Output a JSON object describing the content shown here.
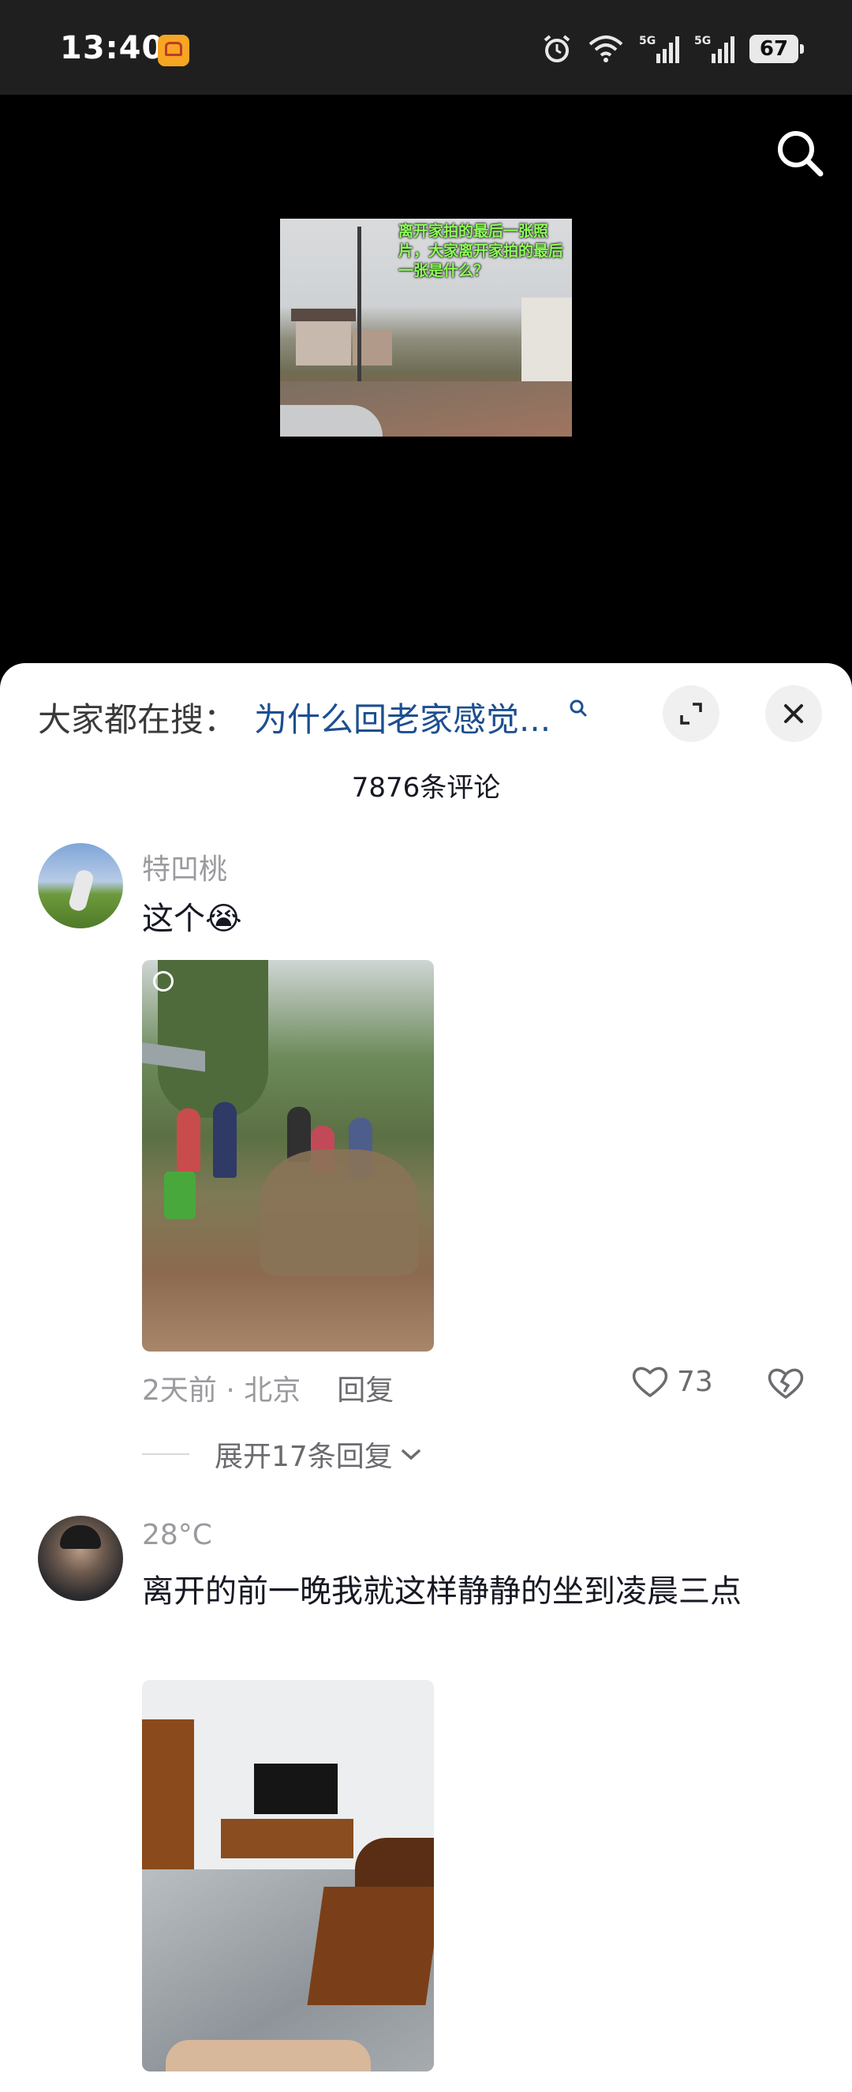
{
  "status_bar": {
    "time": "13:40",
    "battery": "67",
    "icons": [
      "app-icon",
      "alarm-icon",
      "wifi-icon",
      "signal-5g-icon",
      "signal-5g-icon",
      "battery-icon"
    ]
  },
  "video": {
    "caption": "离开家拍的最后一张照片，大家离开家拍的最后一张是什么？"
  },
  "sheet": {
    "trending_label": "大家都在搜：",
    "trending_query": "为什么回老家感觉...",
    "comment_count": "7876条评论"
  },
  "comments": [
    {
      "username": "特凹桃",
      "text": "这个😭",
      "time_location": "2天前 · 北京",
      "reply_label": "回复",
      "likes": "73",
      "expand_replies": "展开17条回复"
    },
    {
      "username": "28°C",
      "text": "离开的前一晚我就这样静静的坐到凌晨三点"
    }
  ],
  "colors": {
    "accent_link": "#1d4f8f",
    "text_primary": "#161823",
    "text_secondary": "#9a9a9f"
  }
}
